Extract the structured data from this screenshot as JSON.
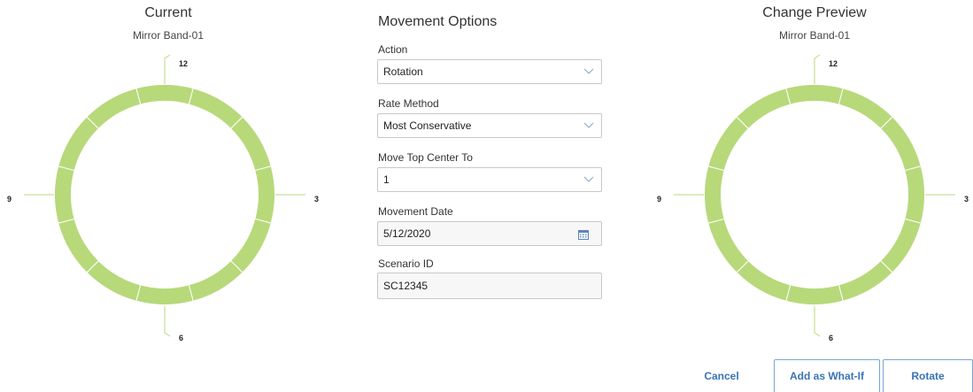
{
  "current": {
    "title": "Current",
    "subtitle": "Mirror Band-01",
    "labels": {
      "top": "12",
      "right": "3",
      "bottom": "6",
      "left": "9"
    }
  },
  "preview": {
    "title": "Change Preview",
    "subtitle": "Mirror Band-01",
    "labels": {
      "top": "12",
      "right": "3",
      "bottom": "6",
      "left": "9"
    }
  },
  "ring": {
    "color": "#b7d97a",
    "segments": 12
  },
  "form": {
    "title": "Movement Options",
    "action": {
      "label": "Action",
      "value": "Rotation"
    },
    "rate_method": {
      "label": "Rate Method",
      "value": "Most Conservative"
    },
    "move_top": {
      "label": "Move Top Center To",
      "value": "1"
    },
    "movement_date": {
      "label": "Movement Date",
      "value": "5/12/2020"
    },
    "scenario_id": {
      "label": "Scenario ID",
      "value": "SC12345"
    }
  },
  "buttons": {
    "cancel": "Cancel",
    "add_what_if": "Add as What-If",
    "rotate": "Rotate"
  },
  "colors": {
    "accent": "#3a74b5",
    "ring": "#b7d97a"
  }
}
